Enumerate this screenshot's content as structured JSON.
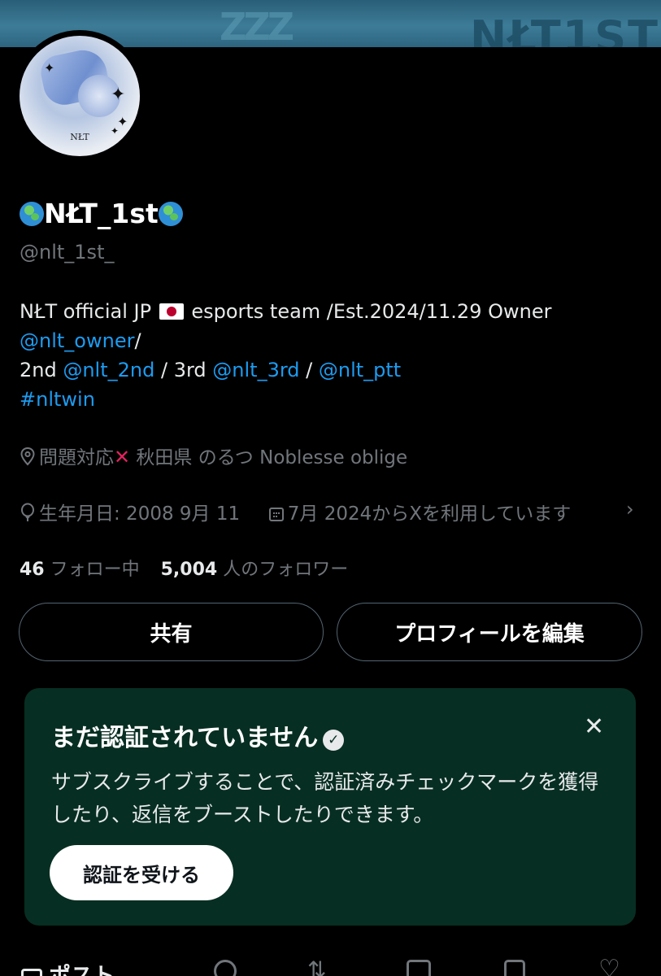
{
  "banner": {
    "text": "NŁT1ST"
  },
  "profile": {
    "avatar_caption": "NŁT",
    "display_name": "NŁT_1st",
    "handle": "@nlt_1st_",
    "bio": {
      "line1": "NŁT official  JP",
      "line1_rest": " esports team /Est.2024/11.29  Owner",
      "owner_link": "@nlt_owner",
      "slash": "/",
      "line3_prefix": "2nd ",
      "link_2nd": "@nlt_2nd",
      "sep1": " / 3rd  ",
      "link_3rd": "@nlt_3rd",
      "sep2": " /  ",
      "link_ptt": "@nlt_ptt",
      "hashtag": "#nltwin"
    },
    "location_a": "問題対応",
    "location_b": " 秋田県 のるつ Noblesse oblige",
    "birthday": "生年月日: 2008 9月 11",
    "joined": "7月 2024からXを利用しています"
  },
  "stats": {
    "following_count": "46",
    "following_label": " フォロー中",
    "followers_count": "5,004",
    "followers_label": " 人のフォロワー"
  },
  "buttons": {
    "share": "共有",
    "edit_profile": "プロフィールを編集"
  },
  "verify_card": {
    "title": "まだ認証されていません",
    "body": "サブスクライブすることで、認証済みチェックマークを獲得したり、返信をブーストしたりできます。",
    "cta": "認証を受ける"
  },
  "tabs": {
    "posts": "ポスト"
  },
  "colors": {
    "link": "#1d9bf0",
    "card_bg": "#072e22",
    "muted": "#71767b"
  }
}
